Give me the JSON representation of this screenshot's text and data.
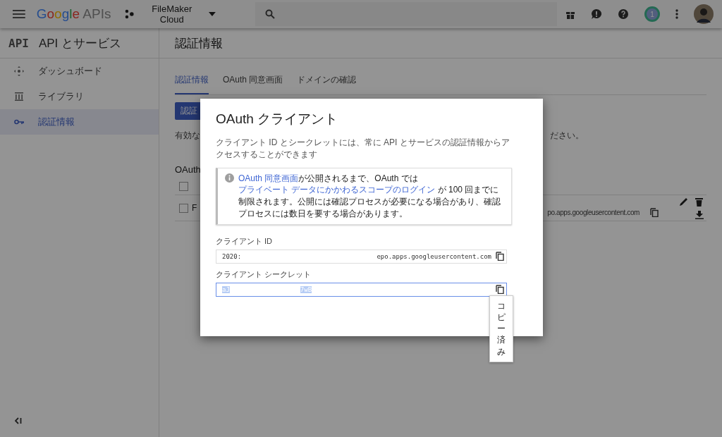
{
  "topbar": {
    "logo_brand": "Google",
    "logo_product": "APIs",
    "project": "FileMaker Cloud",
    "notifications": "1"
  },
  "sidebar": {
    "badge": "API",
    "title": "API とサービス",
    "items": [
      {
        "label": "ダッシュボード",
        "selected": false
      },
      {
        "label": "ライブラリ",
        "selected": false
      },
      {
        "label": "認証情報",
        "selected": true
      }
    ]
  },
  "page": {
    "title": "認証情報",
    "tabs": [
      {
        "label": "認証情報",
        "selected": true
      },
      {
        "label": "OAuth 同意画面",
        "selected": false
      },
      {
        "label": "ドメインの確認",
        "selected": false
      }
    ],
    "create_button": "認証",
    "notice_start": "有効な",
    "notice_end": "ださい。",
    "section_title": "OAuth",
    "table": {
      "header_checked": false,
      "row_checked": false,
      "row_name": "F",
      "row_client_id": "po.apps.googleusercontent.com"
    }
  },
  "dialog": {
    "title": "OAuth クライアント",
    "description": "クライアント ID とシークレットには、常に API とサービスの認証情報からアクセスすることができます",
    "info": [
      {
        "text": "OAuth 同意画面",
        "link": true
      },
      {
        "text": "が公開されるまで、OAuth では",
        "link": false
      },
      {
        "text": "プライベート データにかかわるスコープのログイン",
        "link": true
      },
      {
        "text": " が 100 回までに制限されます。公開には確認プロセスが必要になる場合があり、確認プロセスには数日を要する場合があります。",
        "link": false
      }
    ],
    "fields": [
      {
        "label": "クライアント ID",
        "start": "2020:",
        "end": "epo.apps.googleusercontent.com",
        "focused": false,
        "selected": false
      },
      {
        "label": "クライアント シークレット",
        "start": "aJ",
        "end": "7wB",
        "focused": true,
        "selected": true
      }
    ],
    "tooltip": "コピー済み"
  }
}
